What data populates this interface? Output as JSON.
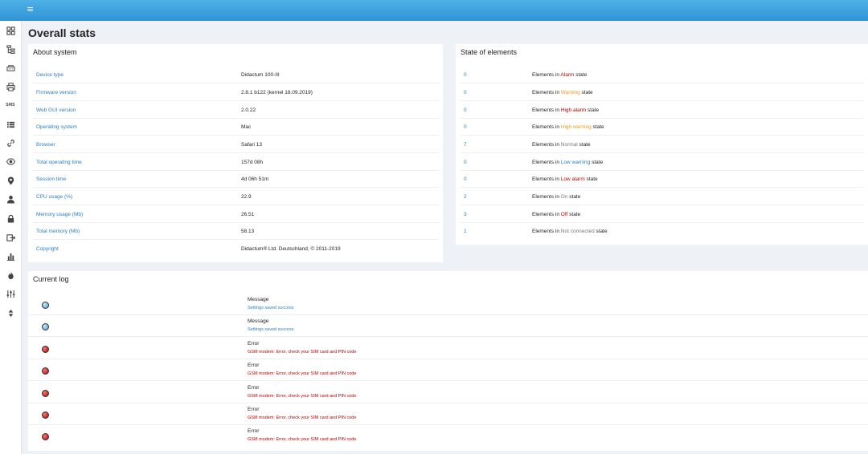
{
  "header": {
    "menu_icon": "hamburger-icon",
    "menu_glyph": "≡"
  },
  "sidebar": {
    "items": [
      {
        "icon": "dashboard-icon"
      },
      {
        "icon": "tree-icon"
      },
      {
        "icon": "device-icon"
      },
      {
        "icon": "printer-icon"
      },
      {
        "icon": "sms-icon",
        "text": "SMS"
      },
      {
        "icon": "list-icon"
      },
      {
        "icon": "link-icon"
      },
      {
        "icon": "eye-icon"
      },
      {
        "icon": "map-marker-icon"
      },
      {
        "icon": "user-icon"
      },
      {
        "icon": "lock-icon"
      },
      {
        "icon": "export-icon"
      },
      {
        "icon": "bar-chart-icon"
      },
      {
        "icon": "fire-icon"
      },
      {
        "icon": "sliders-icon"
      },
      {
        "icon": "sort-icon"
      }
    ]
  },
  "page": {
    "title": "Overall stats"
  },
  "about": {
    "title": "About system",
    "rows": [
      {
        "label": "Device type",
        "value": "Didactum 100-III"
      },
      {
        "label": "Firmware version",
        "value": "2.8.1 b122 (kernel 18.09.2019)"
      },
      {
        "label": "Web GUI version",
        "value": "2.0.22"
      },
      {
        "label": "Operating system",
        "value": "Mac"
      },
      {
        "label": "Browser",
        "value": "Safari 13"
      },
      {
        "label": "Total operating time",
        "value": "157d 08h"
      },
      {
        "label": "Session time",
        "value": "4d 06h 51m"
      },
      {
        "label": "CPU usage (%)",
        "value": "22.9"
      },
      {
        "label": "Memory usage (Mb)",
        "value": "26.51"
      },
      {
        "label": "Total memory (Mb)",
        "value": "58.13"
      },
      {
        "label": "Copyright",
        "value": "Didactum® Ltd. Deutschland, © 2011-2019"
      }
    ]
  },
  "state": {
    "title": "State of elements",
    "prefix": "Elements in",
    "suffix": "state",
    "rows": [
      {
        "count": "0",
        "state": "Alarm",
        "color": "#c00000"
      },
      {
        "count": "0",
        "state": "Warning",
        "color": "#e8a020"
      },
      {
        "count": "0",
        "state": "High alarm",
        "color": "#c00000"
      },
      {
        "count": "0",
        "state": "High warning",
        "color": "#e8a020"
      },
      {
        "count": "7",
        "state": "Normal",
        "color": "#777777"
      },
      {
        "count": "0",
        "state": "Low warning",
        "color": "#2d7ec0"
      },
      {
        "count": "0",
        "state": "Low alarm",
        "color": "#c00000"
      },
      {
        "count": "2",
        "state": "On",
        "color": "#777777"
      },
      {
        "count": "3",
        "state": "Off",
        "color": "#c00000"
      },
      {
        "count": "1",
        "state": "Not connected",
        "color": "#777777"
      }
    ]
  },
  "log": {
    "title": "Current log",
    "entries": [
      {
        "level": "info",
        "type": "Message",
        "text": "Settings saved success"
      },
      {
        "level": "info",
        "type": "Message",
        "text": "Settings saved success"
      },
      {
        "level": "err",
        "type": "Error",
        "text": "GSM modem: Error, check your SIM card and PIN code"
      },
      {
        "level": "err",
        "type": "Error",
        "text": "GSM modem: Error, check your SIM card and PIN code"
      },
      {
        "level": "err",
        "type": "Error",
        "text": "GSM modem: Error, check your SIM card and PIN code"
      },
      {
        "level": "err",
        "type": "Error",
        "text": "GSM modem: Error, check your SIM card and PIN code"
      },
      {
        "level": "err",
        "type": "Error",
        "text": "GSM modem: Error, check your SIM card and PIN code"
      }
    ]
  }
}
